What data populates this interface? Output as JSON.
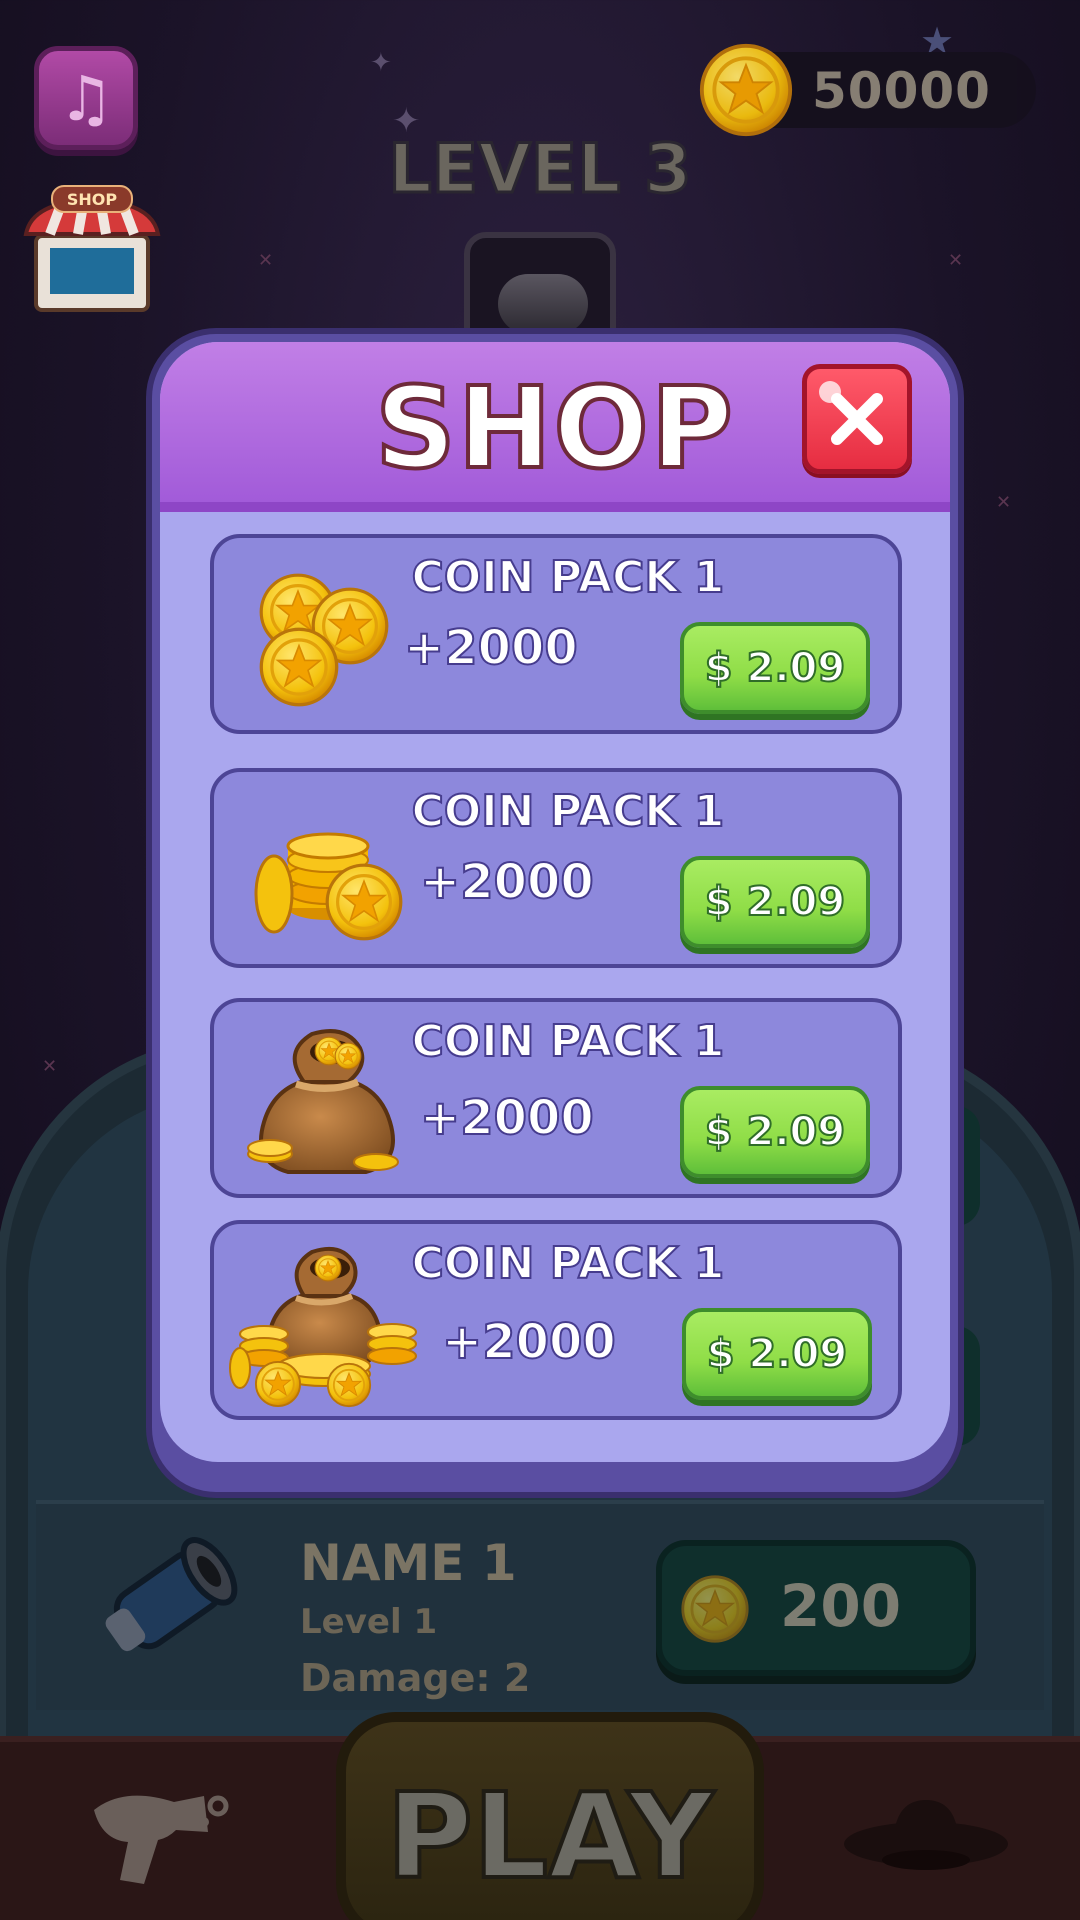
{
  "hud": {
    "coin_balance": "50000",
    "level_title": "LEVEL 3",
    "shop_sign": "SHOP"
  },
  "upgrade_item": {
    "name": "NAME 1",
    "level": "Level 1",
    "damage": "Damage: 2",
    "price": "200"
  },
  "bottom_nav": {
    "play_label": "PLAY"
  },
  "modal": {
    "title": "SHOP",
    "packs": [
      {
        "name": "COIN PACK 1",
        "amount": "+2000",
        "price": "$ 2.09",
        "icon": "coin-trio-icon"
      },
      {
        "name": "COIN PACK 1",
        "amount": "+2000",
        "price": "$ 2.09",
        "icon": "coin-stack-icon"
      },
      {
        "name": "COIN PACK 1",
        "amount": "+2000",
        "price": "$ 2.09",
        "icon": "coin-bag-icon"
      },
      {
        "name": "COIN PACK 1",
        "amount": "+2000",
        "price": "$ 2.09",
        "icon": "coin-treasure-icon"
      }
    ]
  },
  "colors": {
    "modal_header": "#b06ae0",
    "modal_body": "#aaa7ee",
    "pack_panel": "#8d88dc",
    "buy_button": "#8fdd47",
    "close_button": "#e62d41",
    "coin_gold": "#f4c20d"
  }
}
